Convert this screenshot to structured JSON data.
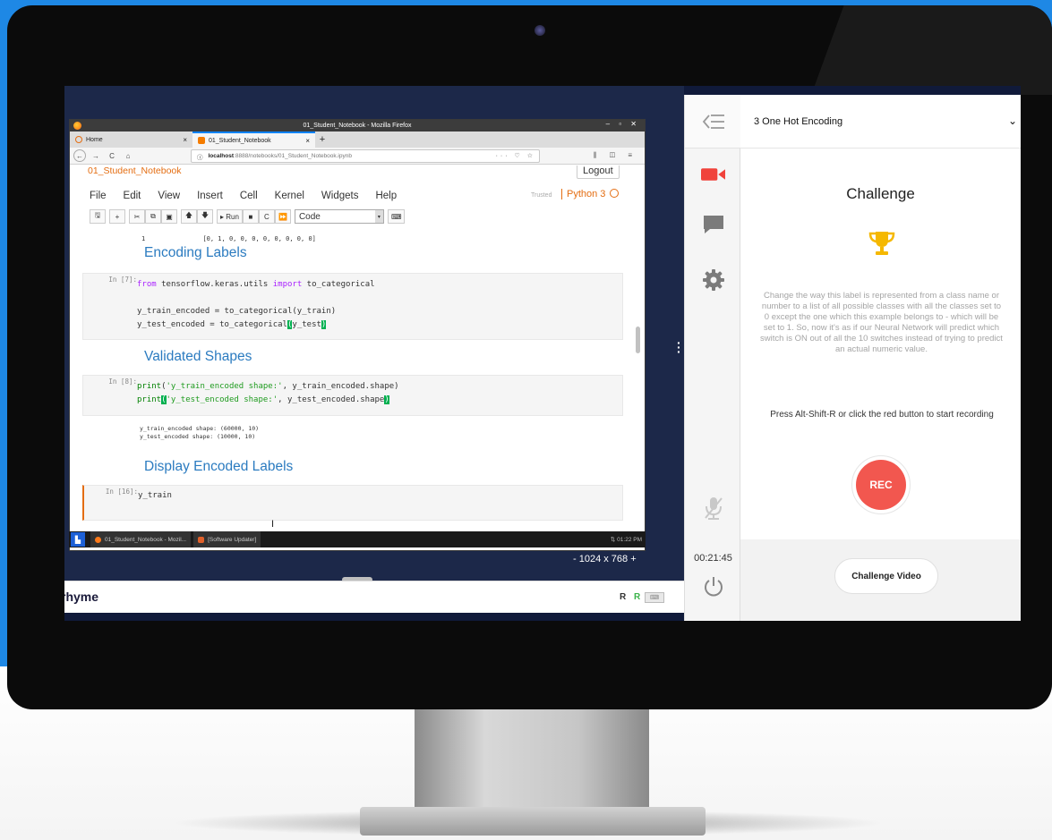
{
  "firefox": {
    "window_title": "01_Student_Notebook - Mozilla Firefox",
    "window_controls": "– ▫ ✕",
    "tabs": [
      {
        "label": "Home",
        "close": "×"
      },
      {
        "label": "01_Student_Notebook",
        "close": "×"
      }
    ],
    "new_tab": "+",
    "url_host": "localhost",
    "url_path": ":8888/notebooks/01_Student_Notebook.ipynb",
    "url_icons": "··· ♡ ☆",
    "nav_right_icons": "⫼ ◫ ≡"
  },
  "jupyter": {
    "notebook_name": "01_Student_Notebook",
    "logout": "Logout",
    "menu": [
      "File",
      "Edit",
      "View",
      "Insert",
      "Cell",
      "Kernel",
      "Widgets",
      "Help"
    ],
    "trusted": "Trusted",
    "kernel": "Python 3",
    "toolbar": {
      "run": "Run",
      "cell_type": "Code"
    },
    "partial_output": {
      "index": "1",
      "values": "[0, 1, 0, 0, 0, 0, 0, 0, 0, 0]"
    },
    "headings": {
      "encoding": "Encoding Labels",
      "validated": "Validated Shapes",
      "display": "Display Encoded Labels"
    },
    "cells": {
      "cell7": {
        "prompt": "In [7]:",
        "l1_kw": "from",
        "l1_mod": " tensorflow.keras.utils ",
        "l1_kw2": "import",
        "l1_name": " to_categorical",
        "l2": "y_train_encoded = to_categorical(y_train)",
        "l3a": "y_test_encoded = to_categorical",
        "l3b": "(",
        "l3c": "y_test",
        "l3d": ")"
      },
      "cell8": {
        "prompt": "In [8]:",
        "l1_fn": "print",
        "l1_paren": "(",
        "l1_str": "'y_train_encoded shape:'",
        "l1_rest": ", y_train_encoded.shape)",
        "l2_fn": "print",
        "l2_paren": "(",
        "l2_str": "'y_test_encoded shape:'",
        "l2_rest": ", y_test_encoded.shape",
        "l2_close": ")",
        "output1": "y_train_encoded shape: (60000, 10)",
        "output2": "y_test_encoded shape: (10000, 10)"
      },
      "cell16": {
        "prompt": "In [16]:",
        "code": "y_train"
      }
    }
  },
  "taskbar": {
    "items": [
      "01_Student_Notebook - Mozil...",
      "[Software Updater]"
    ],
    "clock": "01:22 PM"
  },
  "remote": {
    "resolution": "- 1024 x 768 +"
  },
  "rhyme": {
    "logo": "rhyme",
    "r1": "R",
    "r2": "R"
  },
  "rail": {
    "timer": "00:21:45"
  },
  "panel": {
    "task_title": "3  One Hot Encoding",
    "heading": "Challenge",
    "description": "Change the way this label is represented from a class name or number to a list of all possible classes with all the classes set to 0 except the one which this example belongs to - which will be set to 1.  So, now it's as if our Neural Network will predict which switch is ON out of all the 10 switches instead of trying to predict an actual numeric value.",
    "instruction": "Press Alt-Shift-R or click the red button to start recording",
    "rec_label": "REC",
    "video_button": "Challenge Video"
  },
  "colors": {
    "accent_blue": "#1e88e5",
    "rec_red": "#f2574f",
    "jupyter_orange": "#e46d11",
    "heading_blue": "#2b7bc0",
    "trophy_gold": "#f5b800"
  }
}
